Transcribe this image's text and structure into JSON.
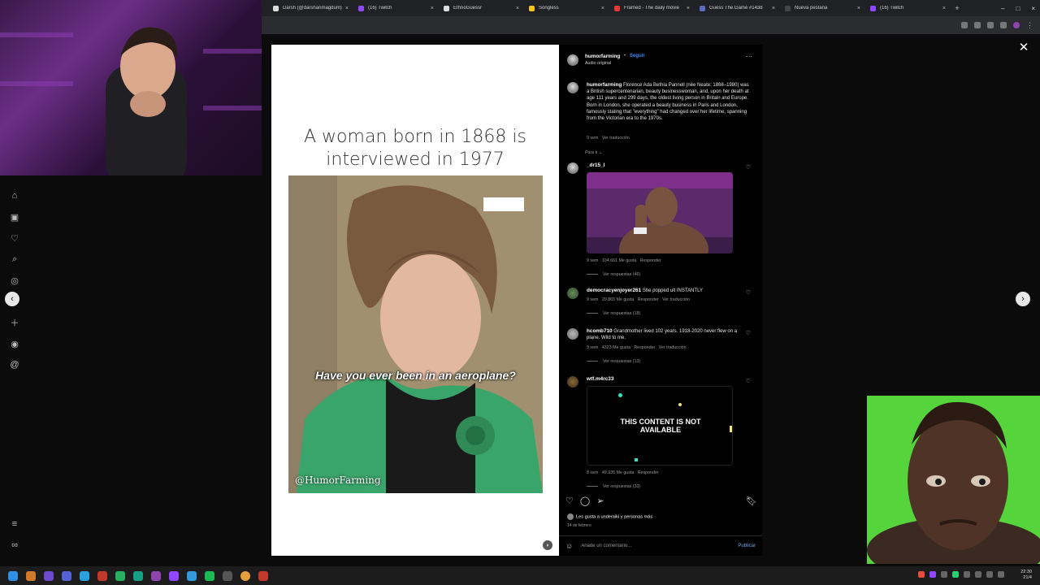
{
  "browser": {
    "tabs": [
      {
        "label": "Darsh (@darshanmagdum)",
        "color": "#dddddd"
      },
      {
        "label": "(16) Twitch",
        "color": "#9146ff"
      },
      {
        "label": "EthnoGuessr",
        "color": "#dddddd"
      },
      {
        "label": "Songless",
        "color": "#f5c518"
      },
      {
        "label": "Framed - The daily movie",
        "color": "#e53935"
      },
      {
        "label": "Guess The.Game #1438",
        "color": "#5c6bc0"
      },
      {
        "label": "Nueva pestaña",
        "color": "#444444"
      },
      {
        "label": "(16) Twitch",
        "color": "#9146ff"
      }
    ],
    "tab_close": "×",
    "new_tab": "+",
    "window_controls": [
      "–",
      "□",
      "×"
    ]
  },
  "post": {
    "media_title": "A woman born in 1868 is interviewed in 1977",
    "subtitle": "Have you ever been in an aeroplane?",
    "watermark": "@HumorFarming",
    "header": {
      "username": "humorfarming",
      "follow": "Seguir",
      "audio": "Audio original",
      "more": "···"
    },
    "caption": {
      "username": "humorfarming",
      "text": "Florence Ada Bethia Pannell (née Neate; 1868–1980) was a British supercentenarian, beauty businesswoman, and, upon her death at age 111 years and 299 days, the oldest living person in Britain and Europe. Born in London, she operated a beauty business in Paris and London, famously stating that \"everything\" had changed over her lifetime, spanning from the Victorian era to the 1970s.",
      "time": "9 sem",
      "translate": "Ver traducción"
    },
    "for_you": "Para ti",
    "comments": [
      {
        "username": "_dr15_l",
        "text": "",
        "meta": [
          "9 sem",
          "104.661 Me gusta",
          "Responder"
        ],
        "replies": "Ver respuestas (46)"
      },
      {
        "username": "democracyenjoyer261",
        "text": "She popped ult INSTANTLY",
        "meta": [
          "9 sem",
          "20.865 Me gusta",
          "Responder",
          "Ver traducción"
        ],
        "replies": "Ver respuestas (18)"
      },
      {
        "username": "hcomb710",
        "text": "Grandmother lived 102 years. 1918-2020 never flew on a plane. Wild to me.",
        "meta": [
          "9 sem",
          "4323 Me gusta",
          "Responder",
          "Ver traducción"
        ],
        "replies": "Ver respuestas (13)"
      },
      {
        "username": "wtf.m4rc33",
        "text": "",
        "thumb_text": "THIS CONTENT IS NOT AVAILABLE",
        "meta": [
          "8 sem",
          "49.935 Me gusta",
          "Responder"
        ],
        "replies": "Ver respuestas (33)"
      }
    ],
    "likes_text": "Les gusta a underaiki y personas más",
    "date": "14 de febrero",
    "comment_placeholder": "Añade un comentario...",
    "publish": "Publicar"
  },
  "icons": {
    "heart": "heart-icon",
    "comment": "comment-icon",
    "share": "share-icon",
    "save": "bookmark-icon",
    "close": "close-icon"
  },
  "colors": {
    "accent": "#3b8cf5",
    "reaction_bg": "#55d43b",
    "twitch": "#9146ff"
  },
  "clock": {
    "time": "22:30",
    "date": "21/4"
  }
}
